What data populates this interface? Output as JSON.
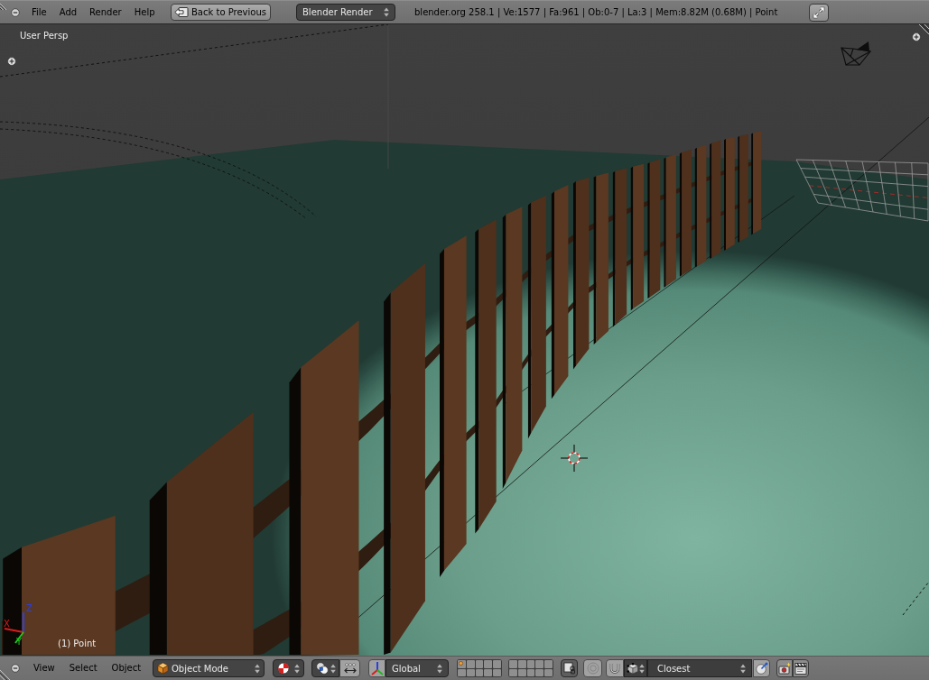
{
  "top_header": {
    "menus": [
      "File",
      "Add",
      "Render",
      "Help"
    ],
    "back_button": "Back to Previous",
    "render_engine": "Blender Render",
    "stats": "blender.org 258.1 | Ve:1577 | Fa:961 | Ob:0-7 | La:3 | Mem:8.82M (0.68M) | Point"
  },
  "viewport": {
    "view_name": "User Persp",
    "object_label": "(1) Point",
    "axis_labels": [
      "X",
      "Y",
      "Z"
    ]
  },
  "bottom_header": {
    "menus": [
      "View",
      "Select",
      "Object"
    ],
    "mode": "Object Mode",
    "manipulator": {
      "pressed": false
    },
    "orientation": "Global",
    "layers": [
      {
        "has_object": true
      },
      {
        "has_object": false
      },
      {
        "has_object": false
      },
      {
        "has_object": false
      },
      {
        "has_object": false
      },
      {
        "has_object": false
      },
      {
        "has_object": false
      },
      {
        "has_object": false
      },
      {
        "has_object": false
      },
      {
        "has_object": false
      },
      {
        "has_object": false
      },
      {
        "has_object": false
      },
      {
        "has_object": false
      },
      {
        "has_object": false
      },
      {
        "has_object": false
      },
      {
        "has_object": false
      },
      {
        "has_object": false
      },
      {
        "has_object": false
      },
      {
        "has_object": false
      },
      {
        "has_object": false
      }
    ],
    "lock_to_scene": {
      "pressed": true
    },
    "proportional_editing": {
      "pressed": false
    },
    "snap": {
      "pressed": false
    },
    "snap_target": "Closest",
    "align_rotation": {
      "pressed": false
    }
  }
}
